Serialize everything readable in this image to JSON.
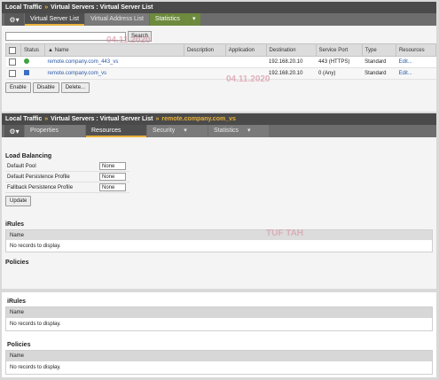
{
  "panel1": {
    "breadcrumb": [
      "Local Traffic",
      "Virtual Servers : Virtual Server List"
    ],
    "tabs": [
      {
        "label": "Virtual Server List"
      },
      {
        "label": "Virtual Address List"
      },
      {
        "label": "Statistics"
      }
    ],
    "search": {
      "value": "",
      "button": "Search"
    },
    "columns": [
      "Status",
      "Name",
      "Description",
      "Application",
      "Destination",
      "Service Port",
      "Type",
      "Resources"
    ],
    "rows": [
      {
        "name": "remote.company.com_443_vs",
        "description": "",
        "application": "",
        "destination": "192.168.20.10",
        "port": "443 (HTTPS)",
        "type": "Standard",
        "resources": "Edit..."
      },
      {
        "name": "remote.company.com_vs",
        "description": "",
        "application": "",
        "destination": "192.168.20.10",
        "port": "0 (Any)",
        "type": "Standard",
        "resources": "Edit..."
      }
    ],
    "buttons": [
      "Enable",
      "Disable",
      "Delete..."
    ]
  },
  "panel2": {
    "breadcrumb": [
      "Local Traffic",
      "Virtual Servers : Virtual Server List",
      "remote.company.com_vs"
    ],
    "tabs": [
      {
        "label": "Properties"
      },
      {
        "label": "Resources"
      },
      {
        "label": "Security"
      },
      {
        "label": "Statistics"
      }
    ],
    "load_balancing": {
      "heading": "Load Balancing",
      "rows": [
        {
          "label": "Default Pool",
          "value": "None"
        },
        {
          "label": "Default Persistence Profile",
          "value": "None"
        },
        {
          "label": "Fallback Persistence Profile",
          "value": "None"
        }
      ],
      "update": "Update"
    },
    "irules": {
      "heading": "iRules",
      "column": "Name",
      "empty": "No records to display."
    },
    "policies": {
      "heading": "Policies"
    }
  },
  "panel3": {
    "irules": {
      "heading": "iRules",
      "column": "Name",
      "empty": "No records to display."
    },
    "policies": {
      "heading": "Policies",
      "column": "Name",
      "empty": "No records to display."
    }
  },
  "watermarks": {
    "date1": "04.11.2020",
    "date2": "04.11.2020",
    "text3": "TUF TAH"
  },
  "colors": {
    "titlebar": "#4a4a4a",
    "accent": "#e8b13a",
    "link": "#2a5aa8",
    "status_green": "#3fa33f",
    "status_blue": "#3a6fc4"
  }
}
